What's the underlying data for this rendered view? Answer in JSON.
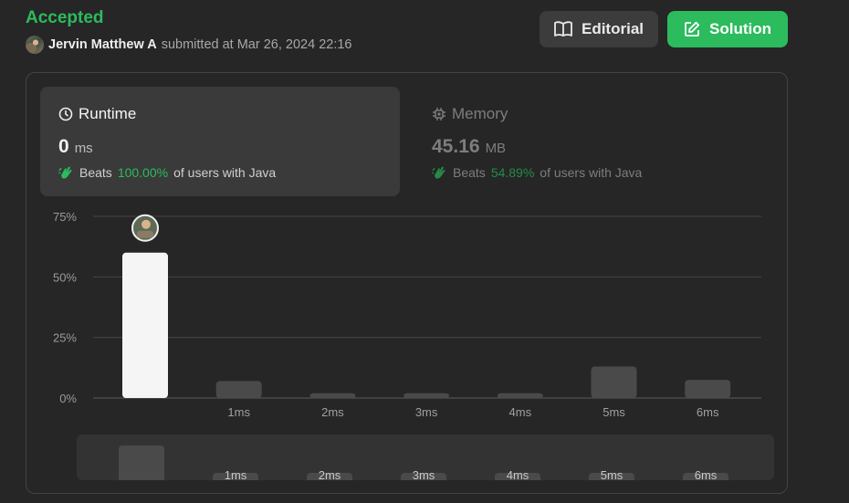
{
  "header": {
    "status": "Accepted",
    "user": "Jervin Matthew A",
    "submitted_text": "submitted at Mar 26, 2024 22:16"
  },
  "buttons": {
    "editorial": "Editorial",
    "solution": "Solution"
  },
  "runtime": {
    "label": "Runtime",
    "value": "0",
    "unit": "ms",
    "beats_prefix": "Beats",
    "beats_pct": "100.00%",
    "beats_suffix": "of users with Java"
  },
  "memory": {
    "label": "Memory",
    "value": "45.16",
    "unit": "MB",
    "beats_prefix": "Beats",
    "beats_pct": "54.89%",
    "beats_suffix": "of users with Java"
  },
  "colors": {
    "accent_green": "#2cbb5d",
    "selected_bar": "#f5f5f5",
    "bar": "#4a4a4a"
  },
  "chart_data": {
    "type": "bar",
    "categories": [
      "",
      "1ms",
      "2ms",
      "3ms",
      "4ms",
      "5ms",
      "6ms"
    ],
    "values": [
      60,
      7,
      2,
      2,
      2,
      13,
      7.5
    ],
    "selected_index": 0,
    "yticks": [
      "0%",
      "25%",
      "50%",
      "75%"
    ],
    "ylim": [
      0,
      75
    ],
    "grid": true
  },
  "mini_chart": {
    "categories": [
      "",
      "1ms",
      "2ms",
      "3ms",
      "4ms",
      "5ms",
      "6ms"
    ]
  }
}
